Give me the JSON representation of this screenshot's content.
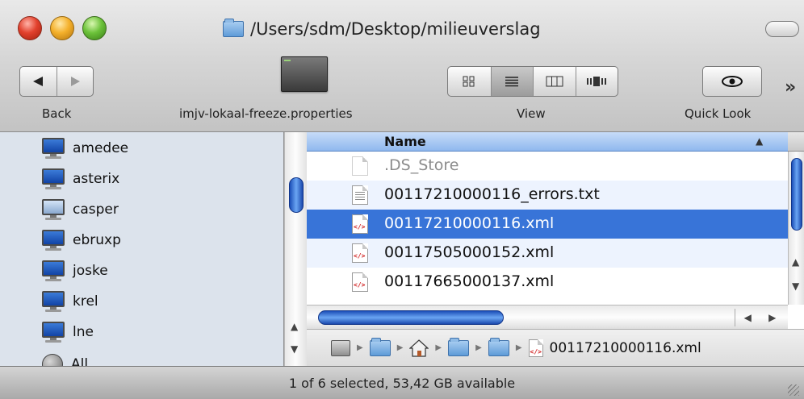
{
  "window": {
    "path_title": "/Users/sdm/Desktop/milieuverslag"
  },
  "toolbar": {
    "back_label": "Back",
    "file_label": "imjv-lokaal-freeze.properties",
    "view_label": "View",
    "quicklook_label": "Quick Look",
    "view_modes": [
      "icon",
      "list",
      "column",
      "coverflow"
    ],
    "active_view": "list",
    "overflow_glyph": "»"
  },
  "sidebar": {
    "items": [
      {
        "label": "amedee",
        "icon": "network-computer-icon"
      },
      {
        "label": "asterix",
        "icon": "network-computer-icon"
      },
      {
        "label": "casper",
        "icon": "network-computer-icon"
      },
      {
        "label": "ebruxp",
        "icon": "network-computer-icon"
      },
      {
        "label": "joske",
        "icon": "network-computer-icon"
      },
      {
        "label": "krel",
        "icon": "network-computer-icon"
      },
      {
        "label": "lne",
        "icon": "network-computer-icon"
      },
      {
        "label": "All",
        "icon": "globe-icon"
      }
    ]
  },
  "file_list": {
    "column_header": "Name",
    "sort_indicator": "▲",
    "rows": [
      {
        "name": ".DS_Store",
        "type": "hidden"
      },
      {
        "name": "00117210000116_errors.txt",
        "type": "text"
      },
      {
        "name": "00117210000116.xml",
        "type": "xml",
        "selected": true
      },
      {
        "name": "00117505000152.xml",
        "type": "xml"
      },
      {
        "name": "00117665000137.xml",
        "type": "xml"
      }
    ]
  },
  "path_bar": {
    "file_name": "00117210000116.xml"
  },
  "status": {
    "text": "1 of 6 selected, 53,42 GB available"
  },
  "colors": {
    "selection": "#3874d8",
    "alt_row": "#edf3fe",
    "header": "#8fb8ee"
  }
}
